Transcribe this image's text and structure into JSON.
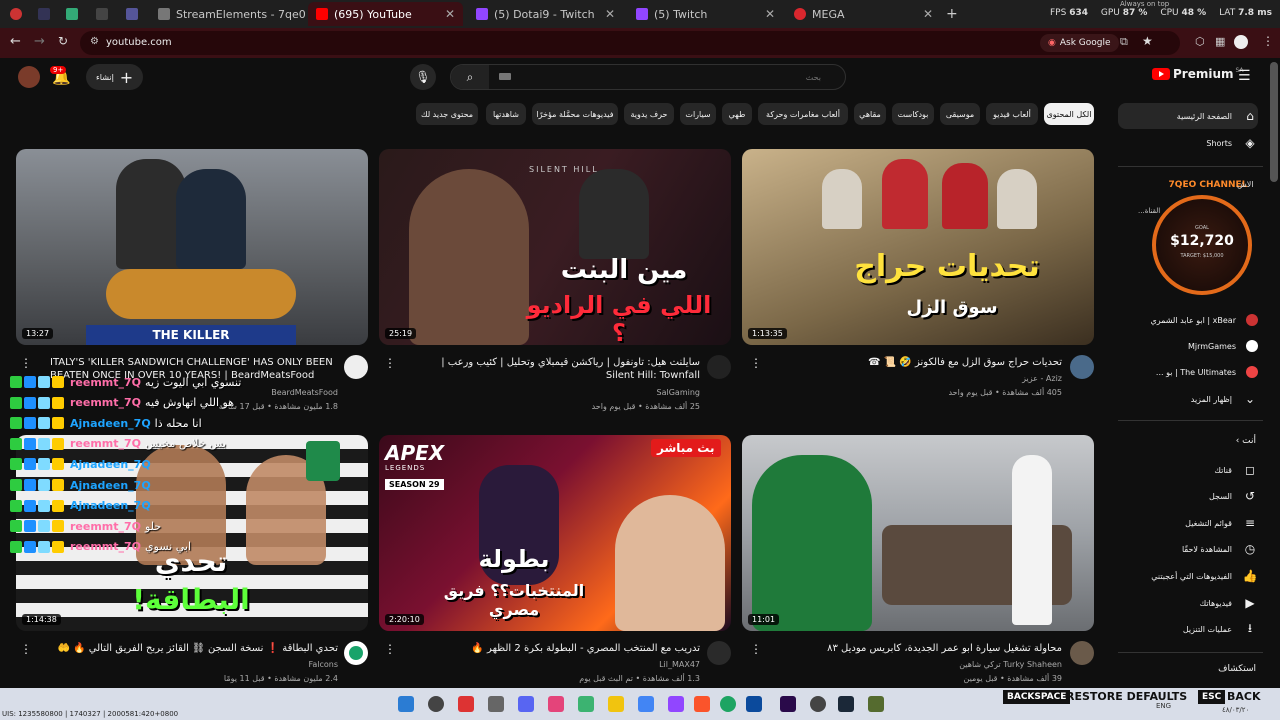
{
  "browser": {
    "tabs": [
      {
        "label": "",
        "fav": "#c33"
      },
      {
        "label": "",
        "fav": "#335"
      },
      {
        "label": "",
        "fav": "#3a7"
      },
      {
        "label": "",
        "fav": "#333"
      },
      {
        "label": "",
        "fav": "#559"
      },
      {
        "label": "StreamElements - 7qe0",
        "fav": "#777"
      },
      {
        "label": "(695) YouTube",
        "fav": "#f00"
      },
      {
        "label": "(5) Dotai9 - Twitch",
        "fav": "#9146ff"
      },
      {
        "label": "(5) Twitch",
        "fav": "#9146ff"
      },
      {
        "label": "MEGA",
        "fav": "#d9272e"
      }
    ],
    "url": "youtube.com",
    "ask_google": "Ask Google",
    "perf": {
      "fps_label": "FPS",
      "fps": "634",
      "gpu_label": "GPU",
      "gpu": "87 %",
      "cpu_label": "CPU",
      "cpu": "48 %",
      "lat_label": "LAT",
      "lat": "7.8 ms",
      "ontop": "Always on top"
    }
  },
  "youtube": {
    "logo": "Premium",
    "region": "SA",
    "search_placeholder": "بحث",
    "create_label": "إنشاء",
    "notif_count": "9+",
    "chips": [
      "الكل المحتوى",
      "ألعاب فيديو",
      "موسيقى",
      "بودكاست",
      "مقاهي",
      "ألعاب مغامرات وحركة",
      "طهي",
      "سيارات",
      "حرف يدوية",
      "فيديوهات محمَّلة مؤخرًا",
      "شاهدتها",
      "محتوى جديد لك"
    ],
    "sidebar": [
      {
        "label": "الصفحة الرئيسية",
        "icon": "home-icon",
        "glyph": "⌂"
      },
      {
        "label": "Shorts",
        "icon": "shorts-icon",
        "glyph": "◈"
      },
      {
        "label": "...القناة",
        "icon": "channel-icon",
        "glyph": ""
      },
      {
        "label": "...",
        "icon": "channel-icon",
        "glyph": ""
      },
      {
        "label": "...",
        "icon": "channel-icon",
        "glyph": ""
      },
      {
        "label": "ابو عابد الشمري | xBear",
        "icon": "channel-icon",
        "glyph": "●"
      },
      {
        "label": "MjrmGames",
        "icon": "channel-icon",
        "glyph": "●"
      },
      {
        "label": "... بو | The Ultimates",
        "icon": "channel-icon",
        "glyph": "●"
      },
      {
        "label": "إظهار المزيد",
        "icon": "chevron-down-icon",
        "glyph": "⌄"
      }
    ],
    "you_section": {
      "header": "أنت",
      "items": [
        {
          "label": "قناتك",
          "icon": "account-icon",
          "glyph": "◻"
        },
        {
          "label": "السجل",
          "icon": "history-icon",
          "glyph": "↺"
        },
        {
          "label": "قوائم التشغيل",
          "icon": "playlist-icon",
          "glyph": "≡"
        },
        {
          "label": "المشاهدة لاحقًا",
          "icon": "clock-icon",
          "glyph": "◷"
        },
        {
          "label": "الفيديوهات التي أعجبتني",
          "icon": "like-icon",
          "glyph": "👍"
        },
        {
          "label": "فيديوهاتك",
          "icon": "video-icon",
          "glyph": "▶"
        },
        {
          "label": "عمليات التنزيل",
          "icon": "download-icon",
          "glyph": "⭳"
        }
      ],
      "explore": "استكشاف"
    },
    "donation": {
      "channel": "7QEO CHANNEL",
      "goal_label": "GOAL",
      "amount": "$12,720",
      "target": "TARGET: $15,000"
    },
    "videos": [
      {
        "title": "تحديات حراج سوق الزل مع فالكونز 🤣 📜 ☎",
        "channel": "Aziz - عزيز",
        "meta": "405 ألف مشاهدة • قبل يوم واحد",
        "duration": "1:13:35",
        "thumb_text": "تحديات حراج",
        "thumb_sub": "سوق الزل"
      },
      {
        "title": "سايلنت هيل: تاونفول | رياكشن قيمبلاي وتحليل | كئيب ورعب | Silent Hill: Townfall",
        "channel": "SalGaming",
        "meta": "25 ألف مشاهدة • قبل يوم واحد",
        "duration": "25:19",
        "thumb_text": "مين البنت",
        "thumb_sub": "اللي في الراديو ؟"
      },
      {
        "title": "ITALY'S 'KILLER SANDWICH CHALLENGE' HAS ONLY BEEN BEATEN ONCE IN OVER 10 YEARS! | BeardMeatsFood",
        "channel": "BeardMeatsFood",
        "meta": "1.8 مليون مشاهدة • قبل 17 ساعة",
        "duration": "13:27",
        "thumb_text": "THE KILLER",
        "thumb_sub": ""
      },
      {
        "title": "محاولة تشغيل سيارة ابو عمر الجديدة، كابريس موديل ٨٣",
        "channel": "Turky Shaheen تركي شاهين",
        "meta": "39 ألف مشاهدة • قبل يومين",
        "duration": "11:01",
        "thumb_text": "",
        "thumb_sub": ""
      },
      {
        "title": "تدريب مع المنتخب المصري - البطولة بكرة 2 الظهر 🔥",
        "channel": "Lil_MAX47",
        "meta": "1.3 ألف مشاهدة • تم البث قبل يوم",
        "duration": "2:20:10",
        "thumb_text": "بطولة",
        "thumb_sub": "المنتخبات؟؟ فريق مصري",
        "live": "بث مباشر",
        "game_title": "APEX",
        "game_sub": "LEGENDS",
        "season": "SEASON 29"
      },
      {
        "title": "تحدي البطاقة ❗ نسخة السجن ⛓ القائز يربح الفريق التالي 🔥 🤲",
        "channel": "Falcons",
        "meta": "2.4 مليون مشاهدة • قبل 11 يومًا",
        "duration": "1:14:38",
        "thumb_text": "تحدي",
        "thumb_sub": "البطاقة!"
      }
    ]
  },
  "chat": [
    {
      "name": "reemmt_7Q",
      "msg": "تنسوي ابي اليوت زيه",
      "color": "#ff6ea9"
    },
    {
      "name": "reemmt_7Q",
      "msg": "هو اللي اتهاوش فيه",
      "color": "#ff6ea9"
    },
    {
      "name": "Ajnadeen_7Q",
      "msg": "انا محله ذا",
      "color": "#1ea4ff"
    },
    {
      "name": "reemmt_7Q",
      "msg": "بس خلاص مخيس",
      "color": "#ff6ea9"
    },
    {
      "name": "Ajnadeen_7Q",
      "msg": "",
      "color": "#1ea4ff"
    },
    {
      "name": "Ajnadeen_7Q",
      "msg": "",
      "color": "#1ea4ff"
    },
    {
      "name": "Ajnadeen_7Q",
      "msg": "",
      "color": "#1ea4ff"
    },
    {
      "name": "reemmt_7Q",
      "msg": "حلو",
      "color": "#ff6ea9"
    },
    {
      "name": "reemmt_7Q",
      "msg": "ابي نسوي",
      "color": "#ff6ea9"
    }
  ],
  "overlay": {
    "backspace": "BACKSPACE",
    "restore": "RESTORE DEFAULTS",
    "esc": "ESC",
    "back": "BACK",
    "lang": "ENG",
    "time": "٤٨/٠٣/٢٠",
    "status": "UIS: 1235580800 | 1740327 | 2000581:420+0800"
  }
}
